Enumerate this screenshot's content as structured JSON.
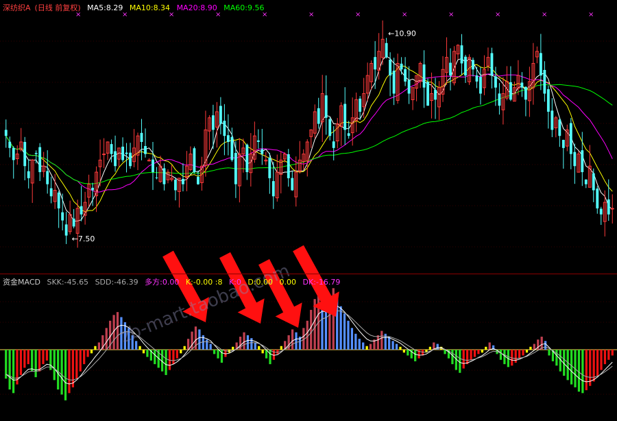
{
  "upper_legend": {
    "stock_name": "深纺织A",
    "period": "(日线 前复权)",
    "ma5": "MA5:8.29",
    "ma10": "MA10:8.34",
    "ma20": "MA20:8.90",
    "ma60": "MA60:9.56"
  },
  "lower_legend": {
    "indicator": "资金MACD",
    "skk": "SKK:-45.65",
    "sdd": "SDD:-46.39",
    "duofang": "多方:0.00",
    "k1": "K:-0.00 :8",
    "k2": "K:0",
    "d": "D:0.00",
    "v": "0.00",
    "dk": "DK:-16.79"
  },
  "watermark": "zb-mart.taobao.com",
  "colors": {
    "up": "#ff3b3b",
    "down": "#54ffff",
    "ma5": "#ffffff",
    "ma10": "#ffff00",
    "ma20": "#ff00ff",
    "ma60": "#00ff00",
    "hist_pos_red": "#c04050",
    "hist_pos_blue": "#5590ff",
    "hist_neg_green": "#22dd22",
    "hist_neg_red": "#ee1111",
    "hist_yellow": "#ffff00",
    "arrow": "#ff1010",
    "grid": "#6b0000"
  },
  "chart_data": [
    {
      "type": "candlestick",
      "title": "深纺织A (日线 前复权)",
      "price_range": [
        7.0,
        11.2
      ],
      "annotations": [
        {
          "text": "10.90",
          "x_index": 100,
          "value": 10.9
        },
        {
          "text": "7.50",
          "x_index": 16,
          "value": 7.5
        }
      ],
      "series": [
        {
          "name": "MA5",
          "value": 8.29
        },
        {
          "name": "MA10",
          "value": 8.34
        },
        {
          "name": "MA20",
          "value": 8.9
        },
        {
          "name": "MA60",
          "value": 9.56
        }
      ],
      "closes": [
        9.2,
        9.0,
        8.8,
        8.9,
        9.1,
        8.7,
        8.5,
        8.8,
        8.9,
        8.6,
        8.7,
        8.4,
        8.2,
        8.3,
        8.0,
        7.8,
        7.55,
        7.9,
        7.7,
        8.0,
        7.9,
        8.1,
        8.4,
        8.3,
        8.6,
        8.8,
        8.9,
        9.1,
        8.9,
        8.7,
        9.0,
        8.8,
        8.9,
        8.7,
        9.0,
        9.2,
        9.1,
        8.9,
        8.8,
        8.6,
        8.5,
        8.7,
        8.4,
        8.6,
        8.5,
        8.3,
        8.5,
        8.4,
        8.7,
        8.9,
        8.6,
        8.4,
        8.7,
        9.3,
        9.5,
        9.3,
        9.6,
        9.4,
        9.2,
        9.1,
        8.8,
        8.4,
        8.9,
        9.0,
        8.6,
        8.9,
        9.2,
        9.1,
        8.9,
        8.8,
        8.5,
        8.2,
        8.6,
        8.8,
        8.9,
        8.5,
        8.3,
        8.6,
        8.8,
        8.9,
        9.1,
        9.3,
        9.6,
        9.4,
        9.9,
        9.5,
        9.2,
        9.0,
        9.4,
        9.7,
        9.3,
        9.2,
        9.5,
        9.8,
        9.6,
        9.9,
        10.2,
        10.4,
        10.3,
        10.6,
        10.8,
        10.5,
        10.2,
        9.9,
        10.4,
        10.3,
        10.1,
        9.9,
        10.0,
        10.2,
        10.4,
        10.0,
        9.7,
        9.9,
        9.8,
        10.0,
        10.3,
        10.5,
        10.2,
        10.6,
        10.7,
        10.4,
        10.2,
        10.5,
        10.3,
        10.1,
        9.9,
        10.3,
        10.5,
        10.2,
        10.0,
        9.7,
        9.9,
        10.1,
        9.8,
        10.0,
        10.2,
        10.0,
        9.8,
        10.1,
        10.4,
        10.6,
        10.2,
        9.9,
        9.6,
        9.3,
        9.5,
        9.2,
        9.0,
        9.3,
        8.9,
        8.7,
        8.9,
        8.6,
        8.4,
        8.7,
        8.3,
        8.0,
        7.9,
        8.1,
        7.9,
        8.0
      ]
    },
    {
      "type": "bar",
      "title": "资金MACD",
      "series": [
        {
          "name": "SKK",
          "value": -45.65
        },
        {
          "name": "SDD",
          "value": -46.39
        },
        {
          "name": "DK",
          "value": -16.79
        }
      ],
      "values": [
        -40,
        -55,
        -60,
        -48,
        -35,
        -25,
        -20,
        -30,
        -38,
        -30,
        -20,
        -15,
        -28,
        -42,
        -55,
        -62,
        -70,
        -60,
        -52,
        -40,
        -30,
        -20,
        -10,
        -5,
        5,
        10,
        20,
        30,
        40,
        48,
        52,
        45,
        38,
        30,
        20,
        12,
        5,
        -5,
        -10,
        -15,
        -20,
        -25,
        -30,
        -35,
        -28,
        -20,
        -12,
        -5,
        5,
        15,
        25,
        32,
        28,
        20,
        14,
        8,
        -6,
        -12,
        -18,
        -10,
        -4,
        4,
        10,
        18,
        24,
        20,
        16,
        10,
        5,
        -5,
        -12,
        -20,
        -14,
        -6,
        5,
        12,
        20,
        28,
        24,
        18,
        30,
        40,
        55,
        70,
        80,
        72,
        60,
        75,
        85,
        70,
        60,
        50,
        40,
        30,
        22,
        15,
        10,
        5,
        8,
        14,
        20,
        26,
        22,
        18,
        12,
        8,
        4,
        -4,
        -8,
        -12,
        -16,
        -12,
        -8,
        -4,
        4,
        10,
        8,
        4,
        -6,
        -12,
        -20,
        -28,
        -32,
        -26,
        -20,
        -14,
        -10,
        -6,
        -4,
        4,
        10,
        6,
        -6,
        -14,
        -20,
        -24,
        -22,
        -18,
        -12,
        -8,
        -4,
        4,
        8,
        14,
        18,
        12,
        -8,
        -16,
        -22,
        -30,
        -36,
        -42,
        -48,
        -52,
        -58,
        -60,
        -56,
        -50,
        -44,
        -36,
        -28,
        -20,
        -14,
        -8
      ]
    }
  ]
}
